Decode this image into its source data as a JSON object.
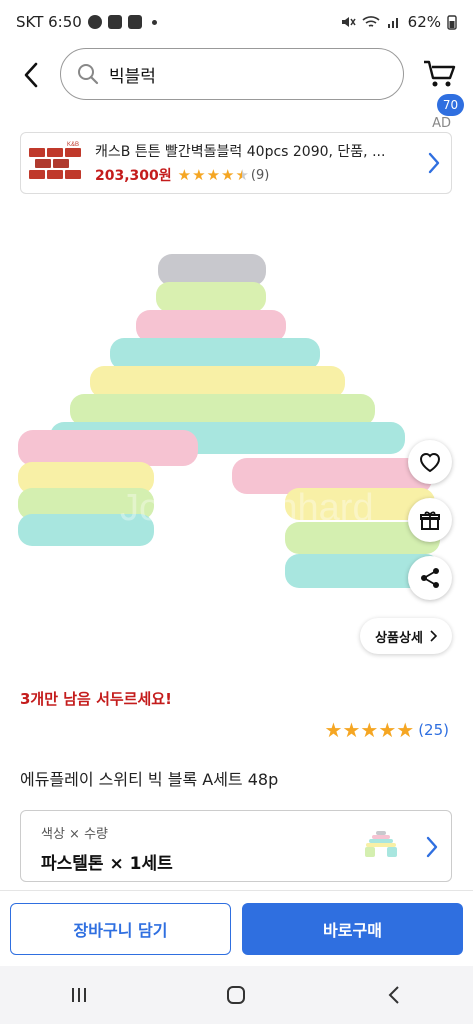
{
  "status_bar": {
    "carrier_time": "SKT 6:50",
    "battery": "62%"
  },
  "search": {
    "value": "빅블럭"
  },
  "cart": {
    "badge": "70"
  },
  "ad": {
    "label": "AD",
    "title": "캐스B 튼튼 빨간벽돌블럭 40pcs 2090, 단품, ...",
    "price": "203,300원",
    "rating": 4.5,
    "review_count": "(9)"
  },
  "product": {
    "watermark": "Joon Yoonhard",
    "detail_button": "상품상세",
    "urgency": "3개만 남음 서두르세요!",
    "rating": 5,
    "review_count": "(25)",
    "title": "에듀플레이 스위티 빅 블록 A세트 48p"
  },
  "option": {
    "label": "색상 × 수량",
    "value": "파스텔톤 × 1세트"
  },
  "actions": {
    "cart_button": "장바구니 담기",
    "buy_button": "바로구매"
  },
  "colors": {
    "accent": "#2f6fe0",
    "price_red": "#c41c1c",
    "star": "#f5a623"
  }
}
